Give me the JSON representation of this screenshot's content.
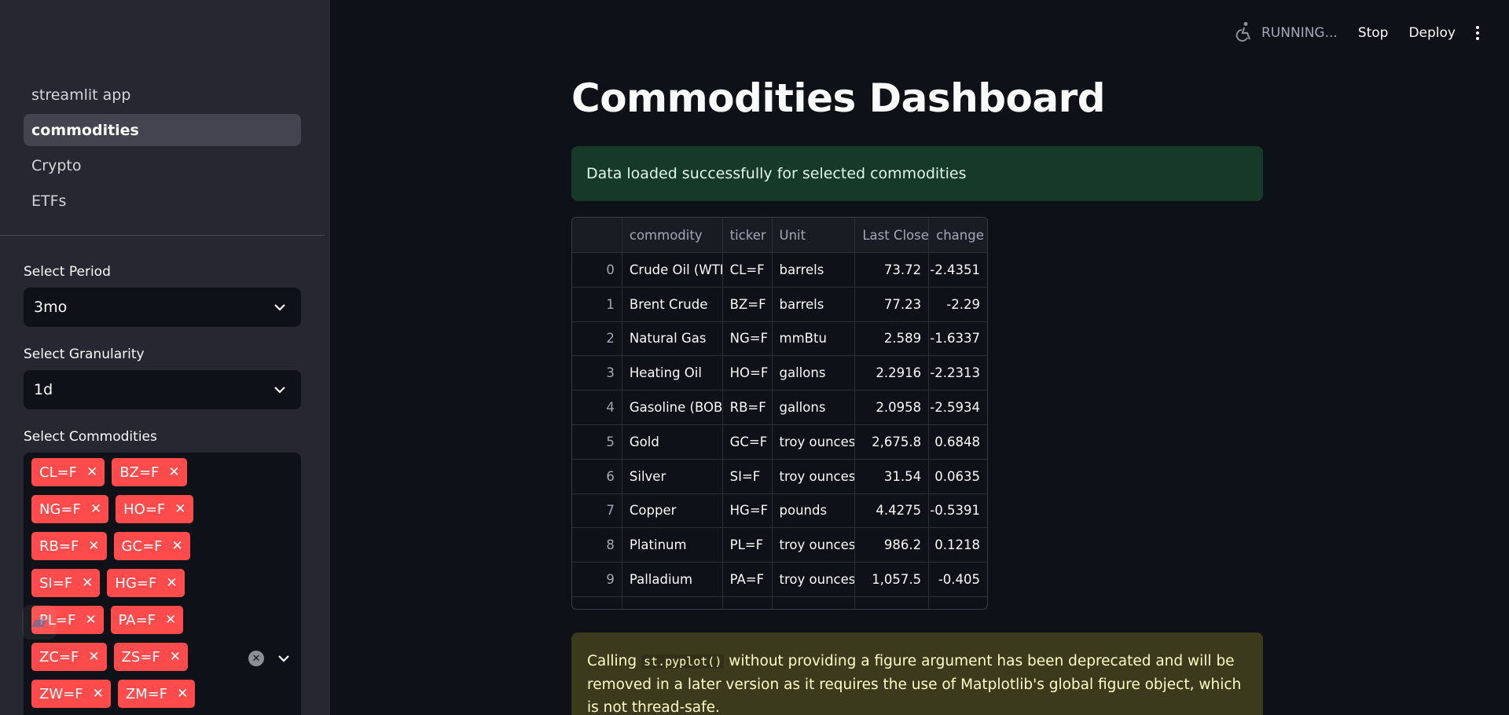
{
  "sidebar": {
    "nav": [
      {
        "label": "streamlit app",
        "active": false
      },
      {
        "label": "commodities",
        "active": true
      },
      {
        "label": "Crypto",
        "active": false
      },
      {
        "label": "ETFs",
        "active": false
      }
    ],
    "period": {
      "label": "Select Period",
      "value": "3mo"
    },
    "granularity": {
      "label": "Select Granularity",
      "value": "1d"
    },
    "commodities": {
      "label": "Select Commodities",
      "tags": [
        "CL=F",
        "BZ=F",
        "NG=F",
        "HO=F",
        "RB=F",
        "GC=F",
        "SI=F",
        "HG=F",
        "PL=F",
        "PA=F",
        "ZC=F",
        "ZS=F",
        "ZW=F",
        "ZM=F"
      ]
    }
  },
  "header": {
    "status": "RUNNING...",
    "stop": "Stop",
    "deploy": "Deploy"
  },
  "main": {
    "title": "Commodities Dashboard",
    "success": "Data loaded successfully for selected commodities",
    "table": {
      "columns": [
        "",
        "commodity",
        "ticker",
        "Unit",
        "Last Close",
        "change"
      ],
      "rows": [
        [
          "0",
          "Crude Oil (WTI)",
          "CL=F",
          "barrels",
          "73.72",
          "-2.4351"
        ],
        [
          "1",
          "Brent Crude",
          "BZ=F",
          "barrels",
          "77.23",
          "-2.29"
        ],
        [
          "2",
          "Natural Gas",
          "NG=F",
          "mmBtu",
          "2.589",
          "-1.6337"
        ],
        [
          "3",
          "Heating Oil",
          "HO=F",
          "gallons",
          "2.2916",
          "-2.2313"
        ],
        [
          "4",
          "Gasoline (BOB)",
          "RB=F",
          "gallons",
          "2.0958",
          "-2.5934"
        ],
        [
          "5",
          "Gold",
          "GC=F",
          "troy ounces",
          "2,675.8",
          "0.6848"
        ],
        [
          "6",
          "Silver",
          "SI=F",
          "troy ounces",
          "31.54",
          "0.0635"
        ],
        [
          "7",
          "Copper",
          "HG=F",
          "pounds",
          "4.4275",
          "-0.5391"
        ],
        [
          "8",
          "Platinum",
          "PL=F",
          "troy ounces",
          "986.2",
          "0.1218"
        ],
        [
          "9",
          "Palladium",
          "PA=F",
          "troy ounces",
          "1,057.5",
          "-0.405"
        ],
        [
          "",
          "",
          "",
          "",
          "",
          ""
        ]
      ]
    },
    "warning": {
      "before": "Calling ",
      "code": "st.pyplot()",
      "after": " without providing a figure argument has been deprecated and will be removed in a later version as it requires the use of Matplotlib's global figure object, which is not thread-safe."
    }
  }
}
